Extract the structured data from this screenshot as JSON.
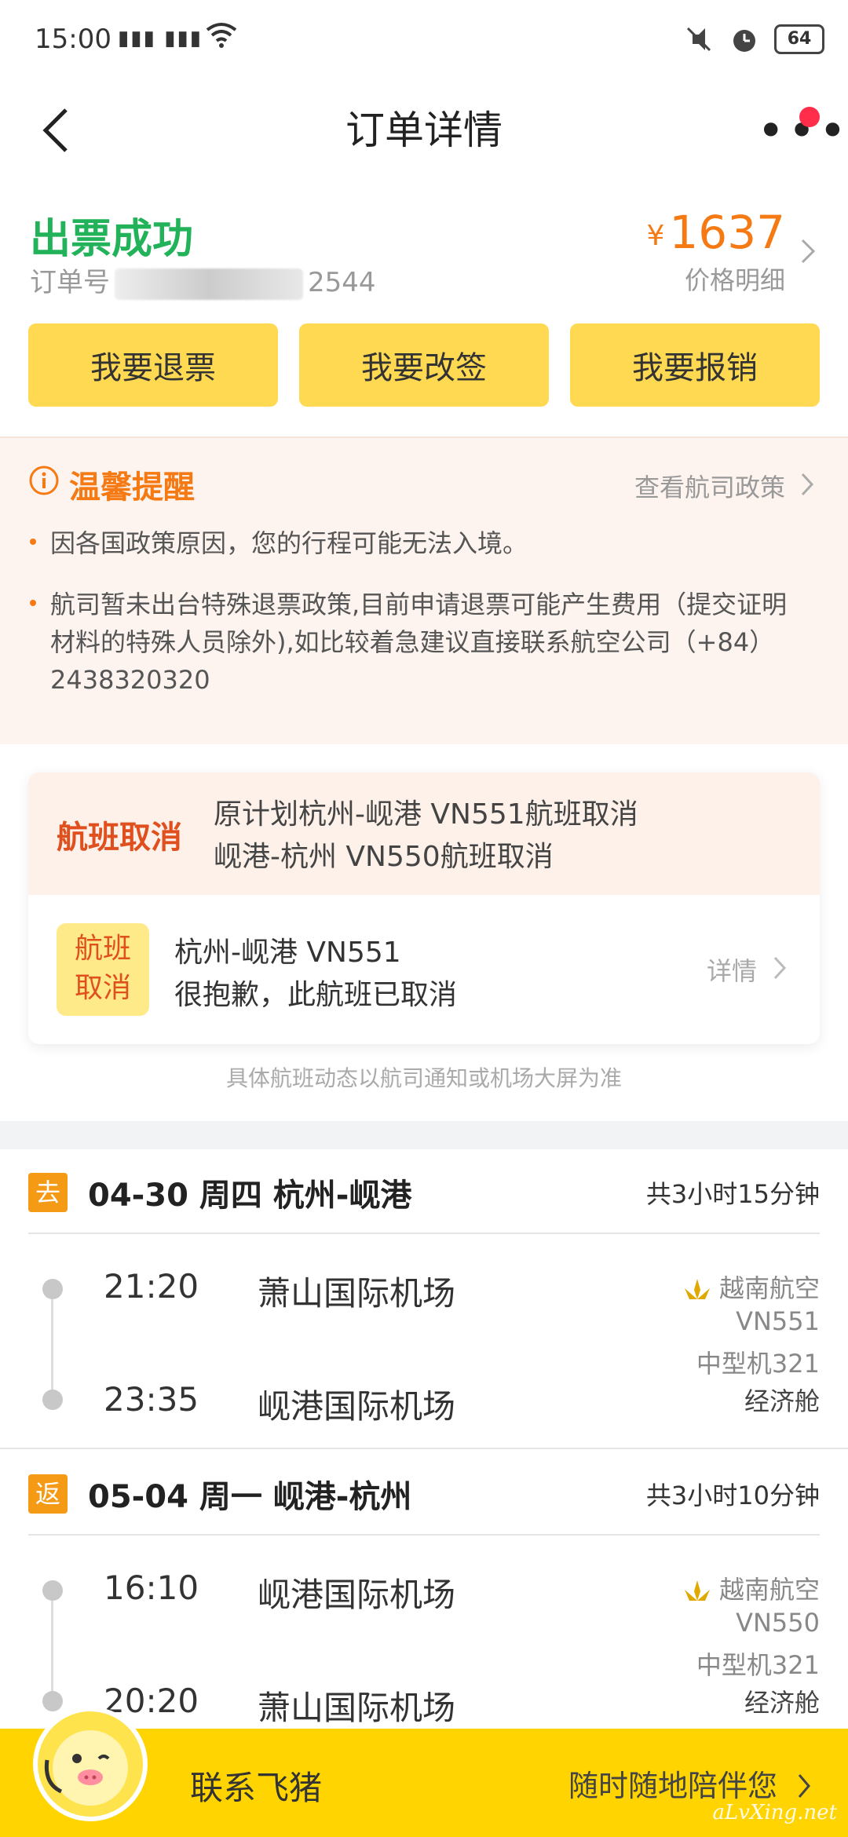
{
  "status_bar": {
    "time": "15:00",
    "signal": "4G 3G",
    "battery": "64"
  },
  "header": {
    "title": "订单详情"
  },
  "order": {
    "status": "出票成功",
    "order_no_label": "订单号",
    "order_no_suffix": "2544",
    "currency": "¥",
    "price": "1637",
    "price_detail": "价格明细"
  },
  "actions": {
    "refund": "我要退票",
    "change": "我要改签",
    "reimburse": "我要报销"
  },
  "tip": {
    "title": "温馨提醒",
    "policy_link": "查看航司政策",
    "item1": "因各国政策原因，您的行程可能无法入境。",
    "item2": "航司暂未出台特殊退票政策,目前申请退票可能产生费用（提交证明材料的特殊人员除外),如比较着急建议直接联系航空公司（+84）2438320320"
  },
  "cancellation": {
    "label": "航班取消",
    "line1": "原计划杭州-岘港 VN551航班取消",
    "line2": "岘港-杭州 VN550航班取消",
    "badge_line1": "航班",
    "badge_line2": "取消",
    "flight": "杭州-岘港 VN551",
    "sorry": "很抱歉，此航班已取消",
    "detail": "详情"
  },
  "disclaimer": "具体航班动态以航司通知或机场大屏为准",
  "segments": [
    {
      "tag": "去",
      "title": "04-30 周四 杭州-岘港",
      "duration": "共3小时15分钟",
      "dep_time": "21:20",
      "dep_airport": "萧山国际机场",
      "arr_time": "23:35",
      "arr_airport": "岘港国际机场",
      "airline": "越南航空",
      "flight_no": "VN551",
      "aircraft": "中型机321",
      "cabin": "经济舱"
    },
    {
      "tag": "返",
      "title": "05-04 周一 岘港-杭州",
      "duration": "共3小时10分钟",
      "dep_time": "16:10",
      "dep_airport": "岘港国际机场",
      "arr_time": "20:20",
      "arr_airport": "萧山国际机场",
      "airline": "越南航空",
      "flight_no": "VN550",
      "aircraft": "中型机321",
      "cabin": "经济舱"
    }
  ],
  "footer": {
    "contact": "联系飞猪",
    "slogan": "随时随地陪伴您",
    "watermark": "aLvXing.net"
  },
  "colors": {
    "accent_yellow": "#ffd952",
    "success_green": "#22b35a",
    "price_orange": "#f57a14",
    "cancel_red": "#e0501f",
    "footer_yellow": "#ffd400"
  }
}
